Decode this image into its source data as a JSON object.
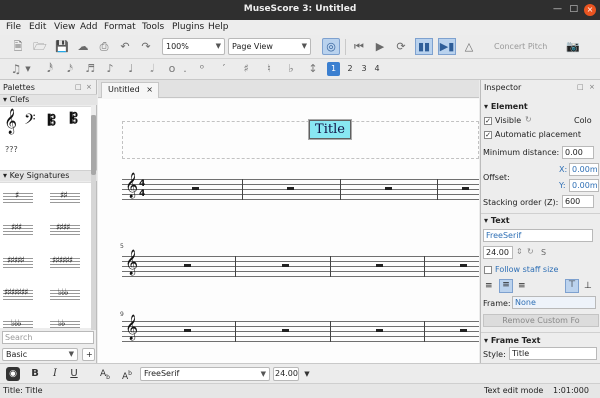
{
  "window": {
    "title": "MuseScore 3: Untitled",
    "close_glyph": "×"
  },
  "menu": [
    "File",
    "Edit",
    "View",
    "Add",
    "Format",
    "Tools",
    "Plugins",
    "Help"
  ],
  "toolbar": {
    "zoom_value": "100%",
    "view_mode": "Page View",
    "concert_pitch_label": "Concert Pitch",
    "voices": [
      "1",
      "2",
      "3",
      "4"
    ]
  },
  "palettes": {
    "title": "Palettes",
    "sections": [
      "Clefs",
      "Key Signatures"
    ],
    "unknown_clef_label": "???",
    "search_placeholder": "Search",
    "workspace": "Basic",
    "add_label": "+"
  },
  "tab": {
    "label": "Untitled",
    "close_glyph": "×"
  },
  "score": {
    "title": "Title",
    "time_signature_top": "4",
    "time_signature_bottom": "4",
    "measure_numbers": [
      "5",
      "9"
    ]
  },
  "inspector": {
    "title": "Inspector",
    "element_header": "Element",
    "visible_label": "Visible",
    "color_label": "Colo",
    "auto_placement_label": "Automatic placement",
    "min_distance_label": "Minimum distance:",
    "min_distance_value": "0.00",
    "offset_label": "Offset:",
    "offset_x_label": "X:",
    "offset_x_value": "0.00m",
    "offset_y_label": "Y:",
    "offset_y_value": "0.00m",
    "stacking_label": "Stacking order (Z):",
    "stacking_value": "600",
    "text_header": "Text",
    "font_value": "FreeSerif",
    "font_size_value": "24.00",
    "font_size_suffix": "S",
    "follow_staff_label": "Follow staff size",
    "frame_label": "Frame:",
    "frame_value": "None",
    "remove_style_label": "Remove Custom Fo",
    "frame_text_header": "Frame Text",
    "style_label": "Style:",
    "style_value": "Title"
  },
  "bottom_toolbar": {
    "bold": "B",
    "italic": "I",
    "underline": "U",
    "subscript": "A",
    "superscript": "A",
    "font": "FreeSerif",
    "size": "24.00"
  },
  "status": {
    "left": "Title: Title",
    "mode": "Text edit mode",
    "time": "1:01:000"
  }
}
